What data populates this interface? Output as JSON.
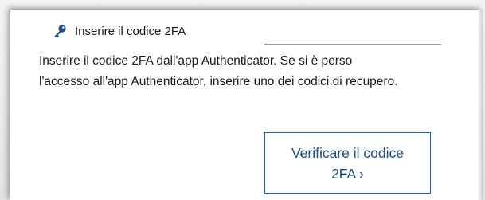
{
  "twofa": {
    "field_label": "Inserire il codice 2FA",
    "input_value": "",
    "description_line1": "Inserire il codice 2FA dall'app Authenticator. Se si è perso",
    "description_line2": "l'accesso all'app Authenticator, inserire uno dei codici di recupero.",
    "verify_line1": "Verificare il codice",
    "verify_line2": "2FA ›",
    "key_icon": "key-icon",
    "accent_color": "#1f4e86"
  }
}
